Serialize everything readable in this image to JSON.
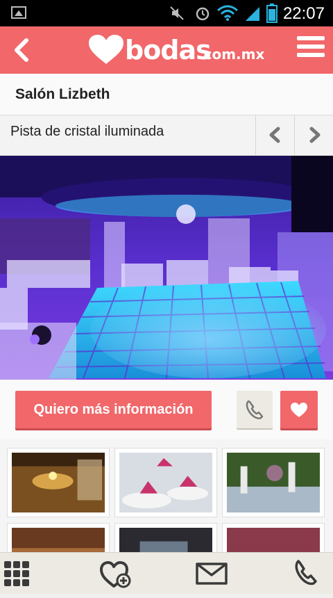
{
  "status_bar": {
    "time": "22:07",
    "icons": [
      "image-notification-icon",
      "mute-icon",
      "alarm-icon",
      "wifi-icon",
      "signal-icon",
      "battery-icon"
    ]
  },
  "header": {
    "logo_word": "bodas",
    "logo_tld": ".com.mx",
    "back_icon": "chevron-left-icon",
    "menu_icon": "hamburger-menu-icon"
  },
  "venue": {
    "name": "Salón Lizbeth"
  },
  "photo": {
    "caption": "Pista de cristal iluminada",
    "prev_icon": "chevron-left-icon",
    "next_icon": "chevron-right-icon"
  },
  "actions": {
    "info_label": "Quiero más información",
    "call_icon": "phone-icon",
    "favorite_icon": "heart-icon"
  },
  "gallery": {
    "thumbnails": 6
  },
  "bottom_nav": {
    "items": [
      "grid-icon",
      "heart-add-icon",
      "mail-icon",
      "phone-icon"
    ]
  },
  "colors": {
    "brand": "#f1676a",
    "header_text": "#ffffff",
    "bottom_bar": "#eceae3"
  }
}
